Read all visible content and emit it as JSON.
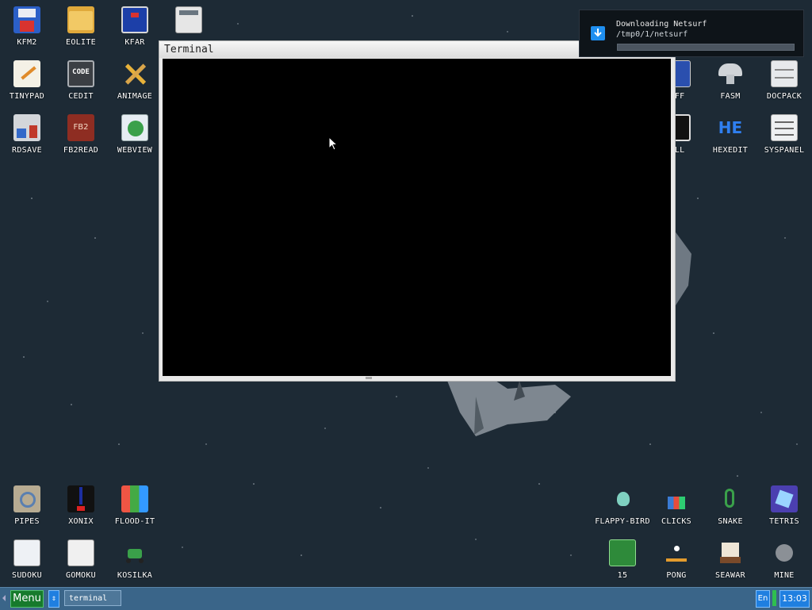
{
  "desktop": {
    "icons": {
      "kfm2": "KFM2",
      "eolite": "EOLITE",
      "kfar": "KFAR",
      "calc": "",
      "tinypad": "TINYPAD",
      "cedit": "CEDIT",
      "animage": "ANIMAGE",
      "rdsave": "RDSAVE",
      "fb2read": "FB2READ",
      "webview": "WEBVIEW",
      "diff": "IFF",
      "fasm": "FASM",
      "docpack": "DOCPACK",
      "shell": "ELL",
      "hexedit": "HEXEDIT",
      "syspanel": "SYSPANEL",
      "pipes": "PIPES",
      "xonix": "XONIX",
      "floodit": "FLOOD-IT",
      "sudoku": "SUDOKU",
      "gomoku": "GOMOKU",
      "kosilka": "KOSILKA",
      "flappy": "FLAPPY-BIRD",
      "clicks": "CLICKS",
      "snake": "SNAKE",
      "tetris": "TETRIS",
      "fifteen": "15",
      "pong": "PONG",
      "seawar": "SEAWAR",
      "mine": "MINE"
    },
    "glyph_text": {
      "cedit": "CODE",
      "fb2read": "FB2",
      "hexedit": "HE"
    }
  },
  "terminal_window": {
    "title": "Terminal"
  },
  "notification": {
    "title": "Downloading Netsurf",
    "path": "/tmp0/1/netsurf",
    "progress": 0.0
  },
  "taskbar": {
    "menu_label": "Menu",
    "switch_icon": "updown-arrows-icon",
    "task_label": "terminal",
    "lang": "En",
    "clock": "13:03"
  },
  "colors": {
    "desktop_bg": "#1d2a35",
    "taskbar_bg": "#3a6589",
    "menu_green": "#167a2c",
    "accent_blue": "#1f7fe0"
  }
}
